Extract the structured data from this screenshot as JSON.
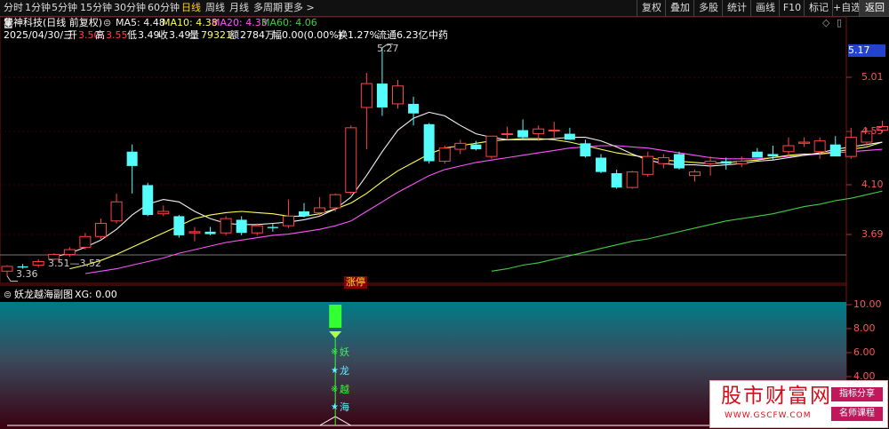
{
  "colors": {
    "up": "#ff4444",
    "down": "#54fcfc",
    "ma5": "#f2f2f2",
    "ma10": "#ffff55",
    "ma20": "#ff55ff",
    "ma60": "#44cc44",
    "xg": "#ffffff",
    "signal": "#33ff33"
  },
  "toolbar": {
    "periods": [
      "分时",
      "1分钟",
      "5分钟",
      "15分钟",
      "30分钟",
      "60分钟",
      "日线",
      "周线",
      "月线",
      "多周期",
      "更多 >"
    ],
    "active_period": "日线",
    "tools": [
      "复权",
      "叠加",
      "多股",
      "统计",
      "画线",
      "F10",
      "标记",
      "+自选",
      "返回"
    ],
    "active_tool": "返回"
  },
  "header": {
    "stock_name": "华神科技(日线 前复权)",
    "ma5": "MA5: 4.48",
    "ma10": "MA10: 4.38",
    "ma20": "MA20: 4.33",
    "ma60": "MA60: 4.06"
  },
  "info_bar": {
    "date": "2025/04/30/三",
    "open_label": "开",
    "open": "3.50",
    "high_label": "高",
    "high": "3.55",
    "low_label": "低",
    "low": "3.49",
    "close_label": "收",
    "close": "3.49",
    "volume_label": "量",
    "volume": "79321",
    "amount_label": "额",
    "amount": "2784万",
    "change": "幅0.00(0.00%)",
    "turnover": "换1.27%",
    "float_value": "流通6.23亿",
    "sector": "中药"
  },
  "price_axis": {
    "current_label": "5.17",
    "ticks": [
      "5.01",
      "4.55",
      "4.10",
      "3.69"
    ]
  },
  "annotations": {
    "high_marker": "5.27",
    "low_marker": "3.36",
    "left_range": "3.51—3.52",
    "limit_up_label": "涨停"
  },
  "indicator": {
    "title": "妖龙越海副图",
    "xg_label": "XG: 0.00",
    "axis_ticks": [
      "10.00",
      "8.00",
      "6.00",
      "4.00"
    ],
    "signal_chars": [
      "妖",
      "龙",
      "越",
      "海"
    ],
    "signal_marks": [
      "※",
      "★",
      "※",
      "★"
    ]
  },
  "watermark": {
    "name": "股市财富网",
    "url": "WWW.GSCFW.COM",
    "badge1": "指标分享",
    "badge2": "名师课程"
  },
  "chart_data": {
    "type": "candlestick",
    "y_range": [
      3.35,
      5.32
    ],
    "indicator_range": [
      0,
      10
    ],
    "candles": [
      {
        "o": 3.4,
        "h": 3.45,
        "l": 3.36,
        "c": 3.44
      },
      {
        "o": 3.44,
        "h": 3.46,
        "l": 3.42,
        "c": 3.43
      },
      {
        "o": 3.45,
        "h": 3.5,
        "l": 3.43,
        "c": 3.48
      },
      {
        "o": 3.5,
        "h": 3.55,
        "l": 3.49,
        "c": 3.54
      },
      {
        "o": 3.54,
        "h": 3.6,
        "l": 3.52,
        "c": 3.58
      },
      {
        "o": 3.6,
        "h": 3.72,
        "l": 3.58,
        "c": 3.69
      },
      {
        "o": 3.69,
        "h": 3.84,
        "l": 3.67,
        "c": 3.8
      },
      {
        "o": 3.82,
        "h": 4.05,
        "l": 3.8,
        "c": 3.98
      },
      {
        "o": 4.4,
        "h": 4.46,
        "l": 4.05,
        "c": 4.28
      },
      {
        "o": 4.12,
        "h": 4.14,
        "l": 3.86,
        "c": 3.87
      },
      {
        "o": 3.88,
        "h": 3.95,
        "l": 3.86,
        "c": 3.9
      },
      {
        "o": 3.86,
        "h": 3.87,
        "l": 3.68,
        "c": 3.7
      },
      {
        "o": 3.72,
        "h": 3.77,
        "l": 3.65,
        "c": 3.73
      },
      {
        "o": 3.73,
        "h": 3.77,
        "l": 3.7,
        "c": 3.71
      },
      {
        "o": 3.72,
        "h": 3.86,
        "l": 3.7,
        "c": 3.84
      },
      {
        "o": 3.83,
        "h": 3.86,
        "l": 3.7,
        "c": 3.72
      },
      {
        "o": 3.72,
        "h": 3.8,
        "l": 3.7,
        "c": 3.78
      },
      {
        "o": 3.77,
        "h": 3.8,
        "l": 3.73,
        "c": 3.76
      },
      {
        "o": 3.78,
        "h": 4.0,
        "l": 3.76,
        "c": 3.86
      },
      {
        "o": 3.9,
        "h": 3.97,
        "l": 3.85,
        "c": 3.86
      },
      {
        "o": 3.89,
        "h": 4.02,
        "l": 3.86,
        "c": 3.93
      },
      {
        "o": 3.93,
        "h": 4.05,
        "l": 3.9,
        "c": 4.04
      },
      {
        "o": 4.06,
        "h": 4.62,
        "l": 4.04,
        "c": 4.6
      },
      {
        "o": 4.77,
        "h": 5.06,
        "l": 4.42,
        "c": 4.97
      },
      {
        "o": 4.97,
        "h": 5.27,
        "l": 4.7,
        "c": 4.77
      },
      {
        "o": 4.8,
        "h": 5.0,
        "l": 4.76,
        "c": 4.95
      },
      {
        "o": 4.8,
        "h": 4.86,
        "l": 4.62,
        "c": 4.72
      },
      {
        "o": 4.63,
        "h": 4.64,
        "l": 4.3,
        "c": 4.32
      },
      {
        "o": 4.32,
        "h": 4.45,
        "l": 4.3,
        "c": 4.43
      },
      {
        "o": 4.42,
        "h": 4.5,
        "l": 4.38,
        "c": 4.47
      },
      {
        "o": 4.46,
        "h": 4.49,
        "l": 4.41,
        "c": 4.42
      },
      {
        "o": 4.36,
        "h": 4.52,
        "l": 4.34,
        "c": 4.53
      },
      {
        "o": 4.55,
        "h": 4.61,
        "l": 4.5,
        "c": 4.55
      },
      {
        "o": 4.58,
        "h": 4.67,
        "l": 4.5,
        "c": 4.52
      },
      {
        "o": 4.55,
        "h": 4.62,
        "l": 4.49,
        "c": 4.59
      },
      {
        "o": 4.58,
        "h": 4.65,
        "l": 4.52,
        "c": 4.58
      },
      {
        "o": 4.55,
        "h": 4.6,
        "l": 4.5,
        "c": 4.5
      },
      {
        "o": 4.47,
        "h": 4.5,
        "l": 4.35,
        "c": 4.36
      },
      {
        "o": 4.35,
        "h": 4.38,
        "l": 4.22,
        "c": 4.23
      },
      {
        "o": 4.22,
        "h": 4.25,
        "l": 4.09,
        "c": 4.1
      },
      {
        "o": 4.1,
        "h": 4.24,
        "l": 4.09,
        "c": 4.23
      },
      {
        "o": 4.21,
        "h": 4.4,
        "l": 4.19,
        "c": 4.36
      },
      {
        "o": 4.3,
        "h": 4.38,
        "l": 4.26,
        "c": 4.35
      },
      {
        "o": 4.38,
        "h": 4.4,
        "l": 4.25,
        "c": 4.26
      },
      {
        "o": 4.2,
        "h": 4.25,
        "l": 4.15,
        "c": 4.23
      },
      {
        "o": 4.3,
        "h": 4.36,
        "l": 4.2,
        "c": 4.32
      },
      {
        "o": 4.32,
        "h": 4.35,
        "l": 4.25,
        "c": 4.3
      },
      {
        "o": 4.3,
        "h": 4.36,
        "l": 4.27,
        "c": 4.32
      },
      {
        "o": 4.4,
        "h": 4.43,
        "l": 4.35,
        "c": 4.35
      },
      {
        "o": 4.38,
        "h": 4.45,
        "l": 4.33,
        "c": 4.36
      },
      {
        "o": 4.4,
        "h": 4.52,
        "l": 4.36,
        "c": 4.45
      },
      {
        "o": 4.47,
        "h": 4.52,
        "l": 4.44,
        "c": 4.48
      },
      {
        "o": 4.4,
        "h": 4.52,
        "l": 4.34,
        "c": 4.49
      },
      {
        "o": 4.46,
        "h": 4.53,
        "l": 4.38,
        "c": 4.36
      },
      {
        "o": 4.36,
        "h": 4.6,
        "l": 4.34,
        "c": 4.52
      },
      {
        "o": 4.48,
        "h": 4.6,
        "l": 4.45,
        "c": 4.57
      },
      {
        "o": 4.58,
        "h": 4.66,
        "l": 4.56,
        "c": 4.61
      }
    ],
    "ma5": [
      3.52,
      3.55,
      3.6,
      3.66,
      3.75,
      3.87,
      3.96,
      4.0,
      3.98,
      3.9,
      3.84,
      3.8,
      3.79,
      3.79,
      3.8,
      3.81,
      3.83,
      3.86,
      3.92,
      4.02,
      4.2,
      4.4,
      4.58,
      4.68,
      4.73,
      4.7,
      4.62,
      4.55,
      4.52,
      4.5,
      4.5,
      4.5,
      4.51,
      4.52,
      4.52,
      4.49,
      4.44,
      4.38,
      4.33,
      4.3,
      4.29,
      4.29,
      4.28,
      4.29,
      4.3,
      4.32,
      4.33,
      4.35,
      4.37,
      4.39,
      4.42,
      4.44,
      4.46,
      4.48
    ],
    "ma10": [
      3.42,
      3.45,
      3.49,
      3.54,
      3.6,
      3.66,
      3.72,
      3.78,
      3.84,
      3.87,
      3.89,
      3.9,
      3.89,
      3.88,
      3.86,
      3.86,
      3.88,
      3.92,
      3.97,
      4.05,
      4.15,
      4.24,
      4.31,
      4.38,
      4.43,
      4.45,
      4.47,
      4.49,
      4.5,
      4.51,
      4.51,
      4.5,
      4.48,
      4.45,
      4.42,
      4.39,
      4.37,
      4.35,
      4.33,
      4.32,
      4.31,
      4.3,
      4.31,
      4.32,
      4.33,
      4.35,
      4.37,
      4.38,
      4.38,
      4.4,
      4.42,
      4.44,
      4.48
    ],
    "ma20": [
      3.38,
      3.4,
      3.42,
      3.45,
      3.48,
      3.51,
      3.55,
      3.58,
      3.61,
      3.64,
      3.66,
      3.68,
      3.7,
      3.71,
      3.73,
      3.75,
      3.78,
      3.82,
      3.9,
      3.98,
      4.06,
      4.13,
      4.2,
      4.25,
      4.28,
      4.31,
      4.33,
      4.35,
      4.37,
      4.39,
      4.41,
      4.43,
      4.44,
      4.45,
      4.45,
      4.44,
      4.43,
      4.41,
      4.39,
      4.37,
      4.35,
      4.34,
      4.34,
      4.34,
      4.35,
      4.36,
      4.37,
      4.38,
      4.39,
      4.4,
      4.41,
      4.42
    ],
    "ma60": [
      3.4,
      3.42,
      3.45,
      3.47,
      3.5,
      3.53,
      3.56,
      3.59,
      3.62,
      3.65,
      3.67,
      3.7,
      3.73,
      3.76,
      3.79,
      3.82,
      3.84,
      3.86,
      3.88,
      3.91,
      3.94,
      3.96,
      3.99,
      4.01,
      4.04,
      4.07
    ],
    "xg": [
      0,
      0,
      0,
      0,
      0,
      0,
      0,
      0,
      0,
      0,
      0,
      0,
      0,
      0,
      0,
      0,
      0,
      0,
      0,
      0,
      0,
      10,
      0,
      0,
      0,
      0,
      0,
      0,
      0,
      0,
      0,
      0,
      0,
      0,
      0,
      0,
      0,
      0,
      0,
      0,
      0,
      0,
      0,
      0,
      0,
      0,
      0,
      0,
      0,
      0,
      0,
      0,
      0,
      0,
      0,
      0,
      0
    ]
  }
}
